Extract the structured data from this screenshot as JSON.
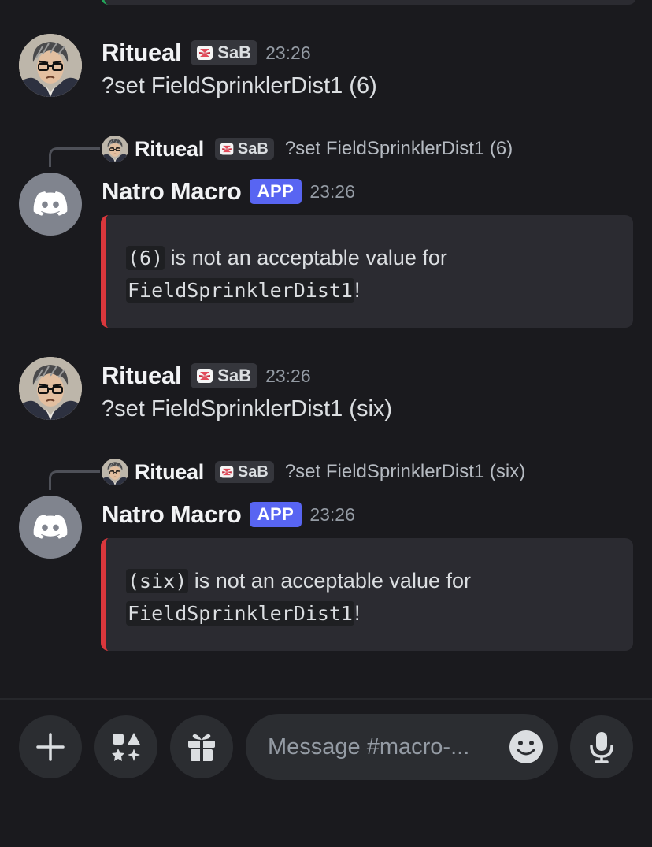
{
  "messages": [
    {
      "author": "Ritueal",
      "tag": "SaB",
      "time": "23:26",
      "text": "?set FieldSprinklerDist1 (6)"
    },
    {
      "reply": {
        "author": "Ritueal",
        "tag": "SaB",
        "text": "?set FieldSprinklerDist1 (6)"
      },
      "author": "Natro Macro",
      "badge": "APP",
      "time": "23:26",
      "embed": {
        "code1": "(6)",
        "mid": " is not an acceptable value for",
        "code2": "FieldSprinklerDist1",
        "end": "!"
      }
    },
    {
      "author": "Ritueal",
      "tag": "SaB",
      "time": "23:26",
      "text": "?set FieldSprinklerDist1 (six)"
    },
    {
      "reply": {
        "author": "Ritueal",
        "tag": "SaB",
        "text": "?set FieldSprinklerDist1 (six)"
      },
      "author": "Natro Macro",
      "badge": "APP",
      "time": "23:26",
      "embed": {
        "code1": "(six)",
        "mid": " is not an acceptable value for",
        "code2": "FieldSprinklerDist1",
        "end": "!"
      }
    }
  ],
  "composer": {
    "placeholder": "Message #macro-...",
    "icons": [
      "plus-icon",
      "apps-icon",
      "gift-icon",
      "emoji-icon",
      "microphone-icon"
    ]
  },
  "colors": {
    "background": "#1a1a1e",
    "embed_bg": "#2b2b31",
    "embed_border": "#da373c",
    "app_badge": "#5865f2",
    "bot_avatar": "#80848e"
  }
}
